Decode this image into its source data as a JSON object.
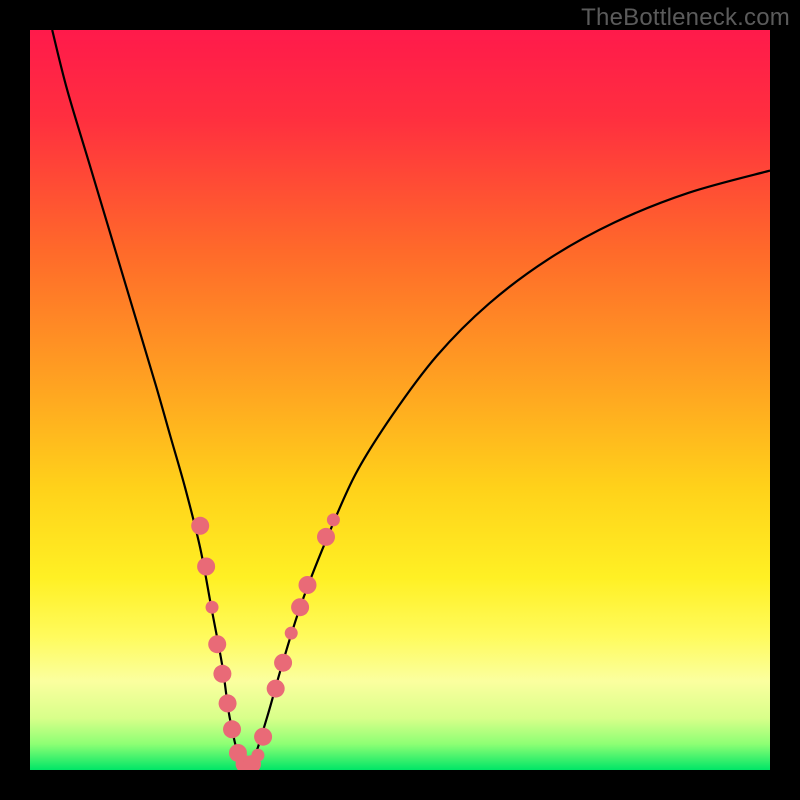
{
  "watermark": "TheBottleneck.com",
  "gradient": {
    "stops": [
      {
        "offset": 0.0,
        "color": "#ff1a4b"
      },
      {
        "offset": 0.12,
        "color": "#ff2f3f"
      },
      {
        "offset": 0.3,
        "color": "#ff6a2a"
      },
      {
        "offset": 0.48,
        "color": "#ffa321"
      },
      {
        "offset": 0.62,
        "color": "#ffd21a"
      },
      {
        "offset": 0.74,
        "color": "#fff024"
      },
      {
        "offset": 0.82,
        "color": "#fffb5d"
      },
      {
        "offset": 0.88,
        "color": "#fbff9f"
      },
      {
        "offset": 0.93,
        "color": "#d8ff8a"
      },
      {
        "offset": 0.965,
        "color": "#8dff74"
      },
      {
        "offset": 1.0,
        "color": "#00e667"
      }
    ]
  },
  "chart_data": {
    "type": "line",
    "title": "",
    "xlabel": "",
    "ylabel": "",
    "xlim": [
      0,
      100
    ],
    "ylim": [
      0,
      100
    ],
    "series": [
      {
        "name": "bottleneck-curve",
        "x": [
          3,
          5,
          8,
          11,
          14,
          17,
          19,
          21,
          23,
          24.5,
          26,
          27,
          28.5,
          30,
          32,
          34,
          36.5,
          40,
          44,
          49,
          55,
          62,
          70,
          79,
          89,
          100
        ],
        "y": [
          100,
          92,
          82,
          72,
          62,
          52,
          45,
          38,
          30,
          22,
          14,
          7,
          1,
          1,
          7,
          14,
          22,
          31,
          40,
          48,
          56,
          63,
          69,
          74,
          78,
          81
        ]
      }
    ],
    "markers": {
      "name": "data-points",
      "color": "#e96a77",
      "radius_large": 9,
      "radius_small": 6.5,
      "points": [
        {
          "x": 23.0,
          "y": 33.0,
          "r": "l"
        },
        {
          "x": 23.8,
          "y": 27.5,
          "r": "l"
        },
        {
          "x": 24.6,
          "y": 22.0,
          "r": "s"
        },
        {
          "x": 25.3,
          "y": 17.0,
          "r": "l"
        },
        {
          "x": 26.0,
          "y": 13.0,
          "r": "l"
        },
        {
          "x": 26.7,
          "y": 9.0,
          "r": "l"
        },
        {
          "x": 27.3,
          "y": 5.5,
          "r": "l"
        },
        {
          "x": 28.1,
          "y": 2.3,
          "r": "l"
        },
        {
          "x": 29.0,
          "y": 0.8,
          "r": "l"
        },
        {
          "x": 30.0,
          "y": 0.8,
          "r": "l"
        },
        {
          "x": 30.8,
          "y": 2.0,
          "r": "s"
        },
        {
          "x": 31.5,
          "y": 4.5,
          "r": "l"
        },
        {
          "x": 33.2,
          "y": 11.0,
          "r": "l"
        },
        {
          "x": 34.2,
          "y": 14.5,
          "r": "l"
        },
        {
          "x": 35.3,
          "y": 18.5,
          "r": "s"
        },
        {
          "x": 36.5,
          "y": 22.0,
          "r": "l"
        },
        {
          "x": 37.5,
          "y": 25.0,
          "r": "l"
        },
        {
          "x": 40.0,
          "y": 31.5,
          "r": "l"
        },
        {
          "x": 41.0,
          "y": 33.8,
          "r": "s"
        }
      ]
    }
  }
}
